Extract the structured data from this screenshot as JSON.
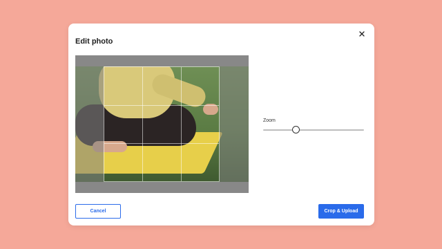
{
  "dialog": {
    "title": "Edit photo",
    "close_icon": "close-icon"
  },
  "editor": {
    "image_description": "photo",
    "zoom_label": "Zoom",
    "zoom_value": 0.32
  },
  "footer": {
    "cancel_label": "Cancel",
    "primary_label": "Crop & Upload"
  },
  "colors": {
    "background": "#F5A899",
    "accent": "#2A6BEA"
  }
}
